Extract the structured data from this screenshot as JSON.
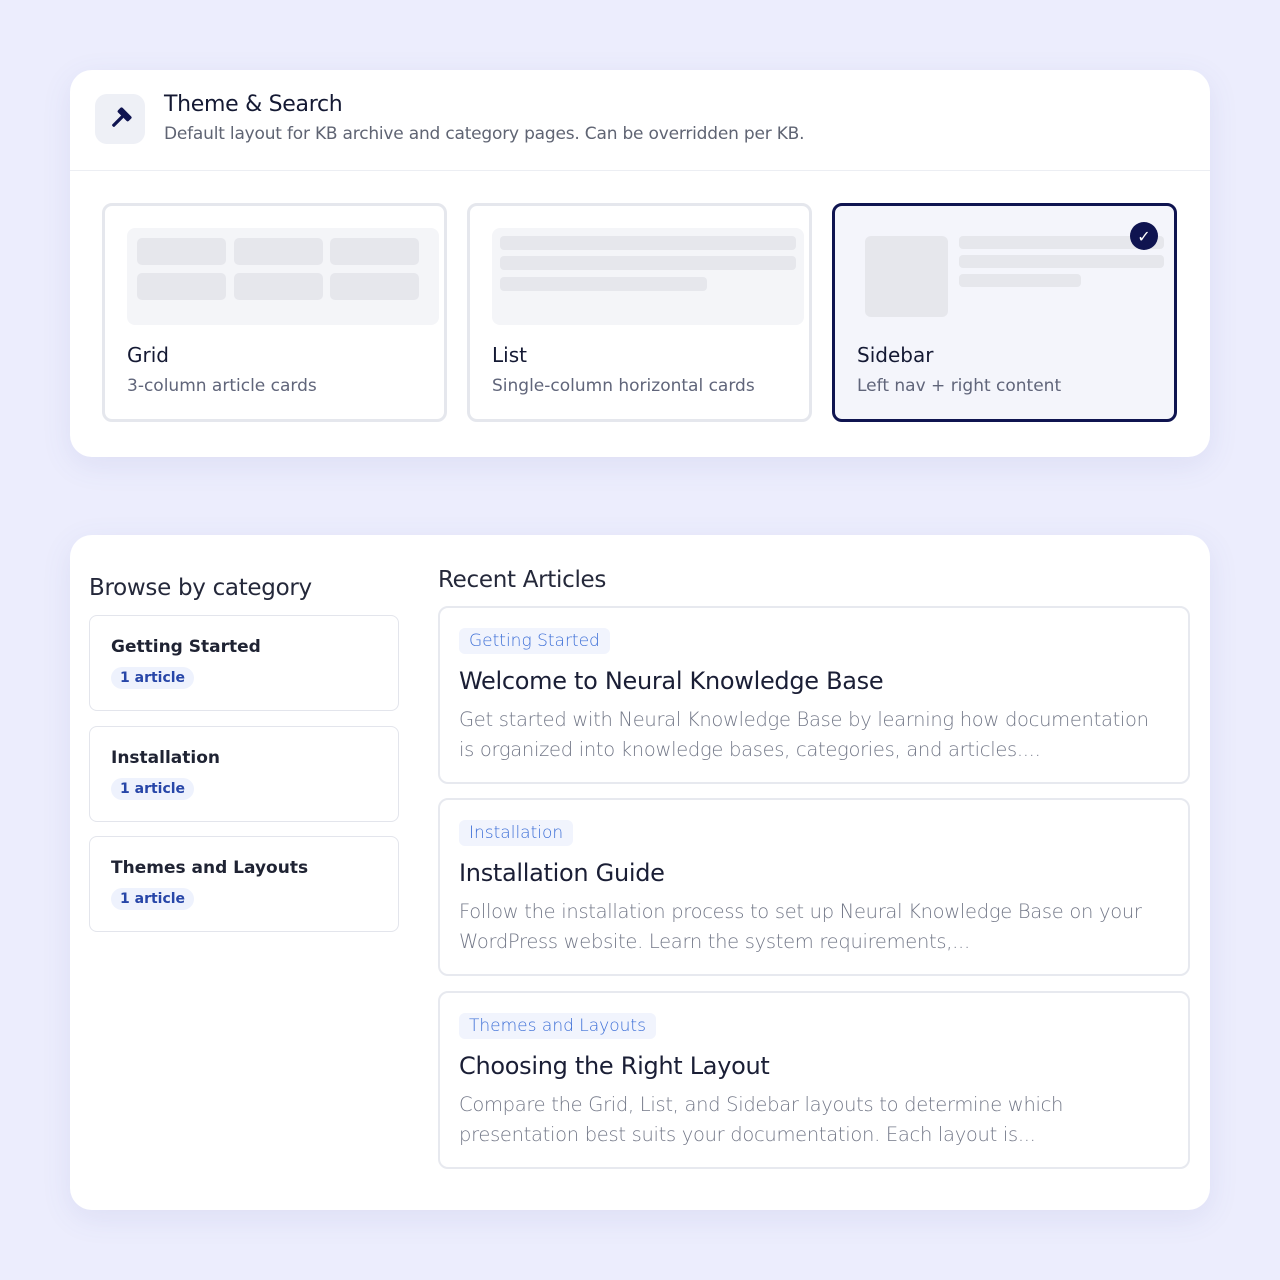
{
  "settings": {
    "icon": "hammer-icon",
    "title": "Theme & Search",
    "subtitle": "Default layout for KB archive and category pages. Can be overridden per KB.",
    "layouts": [
      {
        "name": "Grid",
        "description": "3-column article cards",
        "selected": false
      },
      {
        "name": "List",
        "description": "Single-column horizontal cards",
        "selected": false
      },
      {
        "name": "Sidebar",
        "description": "Left nav + right content",
        "selected": true
      }
    ],
    "selected_check": "✓",
    "accent_color": "#0f1450"
  },
  "browse": {
    "title": "Browse by category",
    "categories": [
      {
        "name": "Getting Started",
        "count": "1 article"
      },
      {
        "name": "Installation",
        "count": "1 article"
      },
      {
        "name": "Themes and Layouts",
        "count": "1 article"
      }
    ]
  },
  "recent": {
    "title": "Recent Articles",
    "articles": [
      {
        "category": "Getting Started",
        "title": "Welcome to Neural Knowledge Base",
        "excerpt": "Get started with Neural Knowledge Base by learning how documentation is organized into knowledge bases, categories, and articles...."
      },
      {
        "category": "Installation",
        "title": "Installation Guide",
        "excerpt": "Follow the installation process to set up Neural Knowledge Base on your WordPress website. Learn the system requirements,..."
      },
      {
        "category": "Themes and Layouts",
        "title": "Choosing the Right Layout",
        "excerpt": "Compare the Grid, List, and Sidebar layouts to determine which presentation best suits your documentation. Each layout is..."
      }
    ]
  }
}
